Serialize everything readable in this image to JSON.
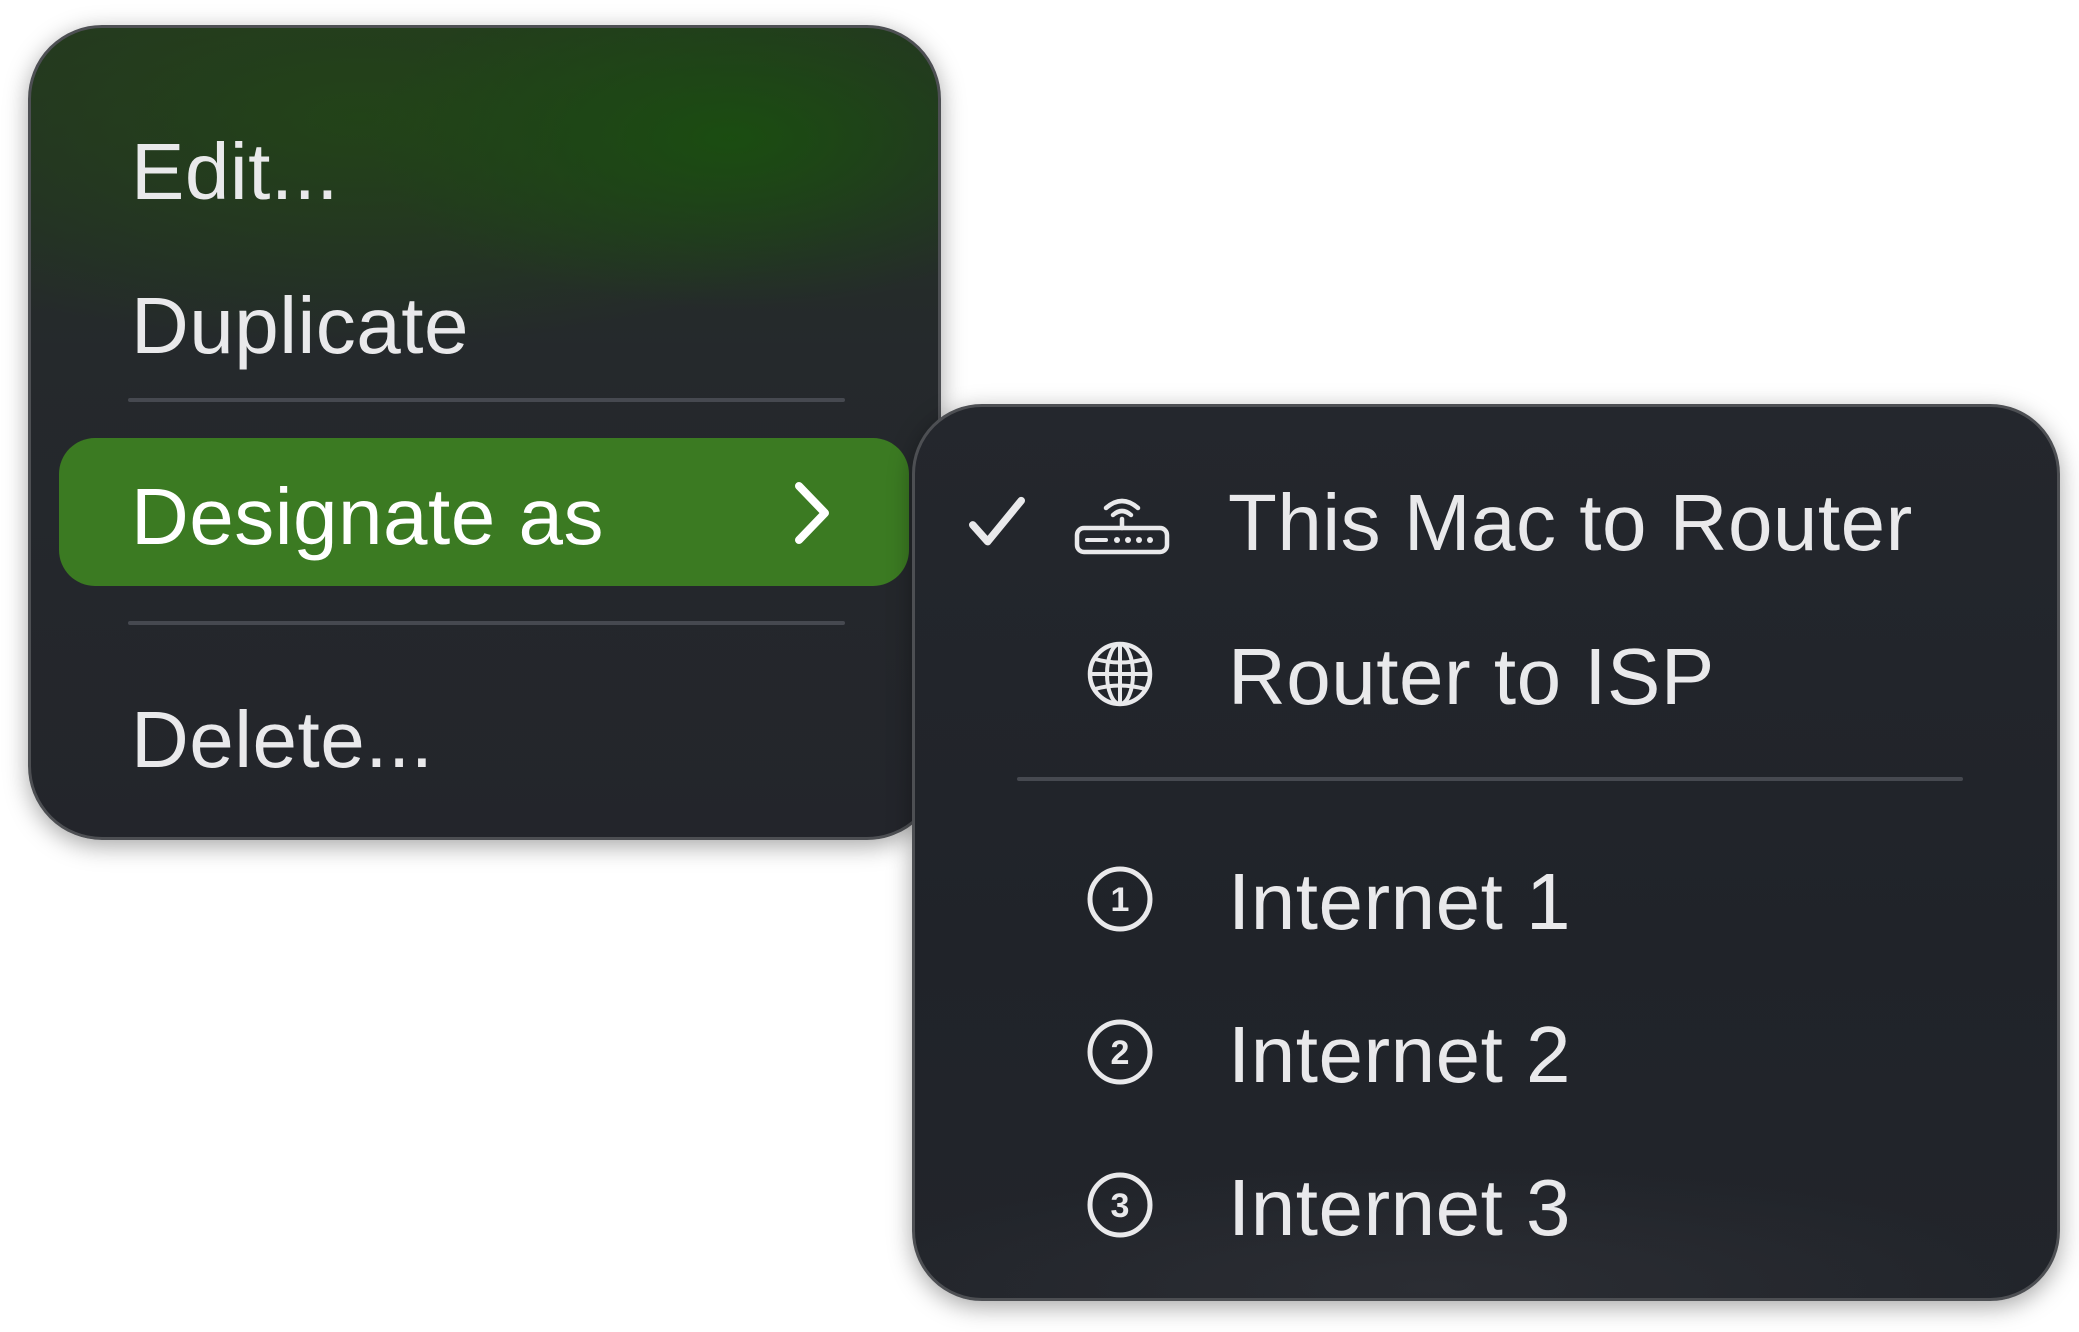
{
  "context_menu": {
    "items": [
      {
        "label": "Edit..."
      },
      {
        "label": "Duplicate"
      },
      {
        "label": "Designate as",
        "has_submenu": true,
        "highlighted": true
      },
      {
        "label": "Delete..."
      }
    ],
    "highlight_color": "#3b7a22"
  },
  "submenu": {
    "items": [
      {
        "label": "This Mac to Router",
        "icon": "router-icon",
        "checked": true
      },
      {
        "label": "Router to ISP",
        "icon": "globe-icon"
      },
      {
        "label": "Internet 1",
        "icon": "circled-1-icon"
      },
      {
        "label": "Internet 2",
        "icon": "circled-2-icon"
      },
      {
        "label": "Internet 3",
        "icon": "circled-3-icon"
      }
    ]
  },
  "icon_glyphs": {
    "circled_1": "1",
    "circled_2": "2",
    "circled_3": "3"
  }
}
